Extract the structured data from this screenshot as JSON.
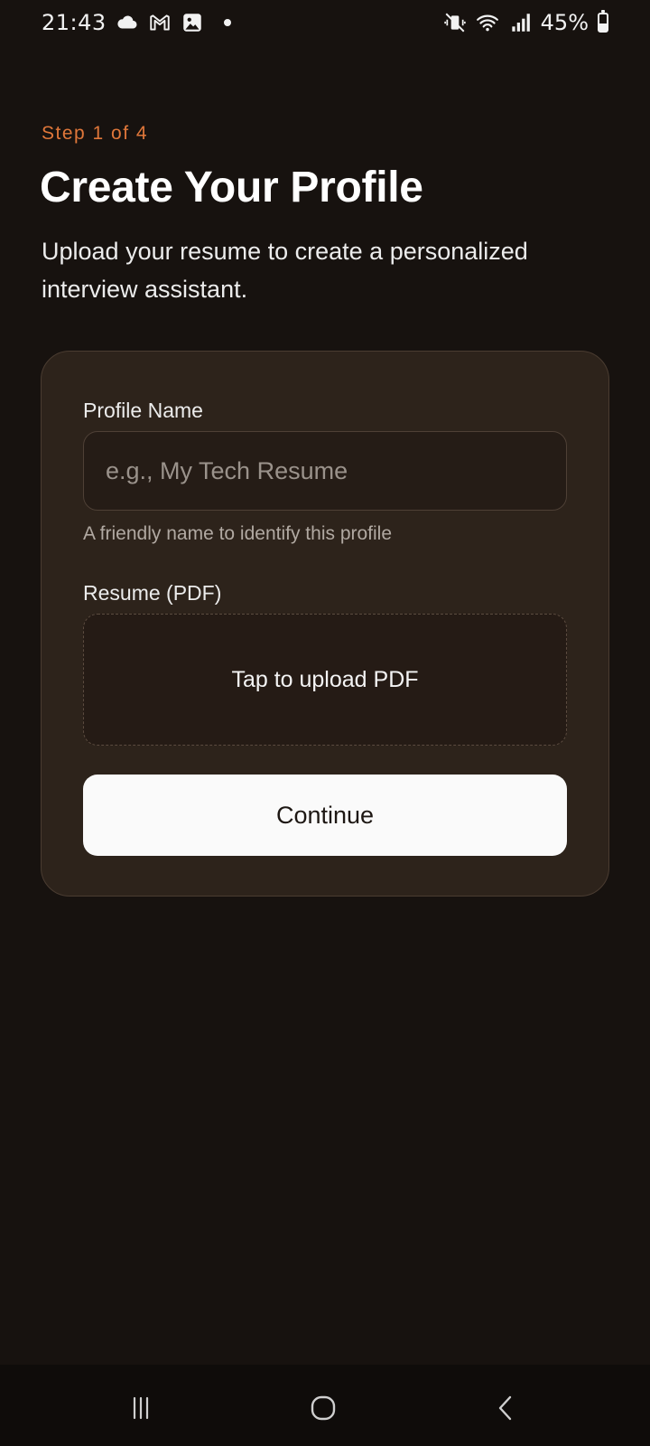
{
  "status_bar": {
    "time": "21:43",
    "battery": "45%",
    "battery_level": 0.45,
    "icons": [
      "cloud-icon",
      "gmail-icon",
      "gallery-icon",
      "notification-dot-icon",
      "mute-vibrate-icon",
      "wifi-icon",
      "signal-icon",
      "battery-icon"
    ]
  },
  "header": {
    "step": "Step 1 of 4",
    "title": "Create Your Profile",
    "subtitle": "Upload your resume to create a personalized interview assistant."
  },
  "form": {
    "profile_name": {
      "label": "Profile Name",
      "placeholder": "e.g., My Tech Resume",
      "value": "",
      "helper": "A friendly name to identify this profile"
    },
    "resume": {
      "label": "Resume (PDF)",
      "upload_text": "Tap to upload PDF"
    },
    "continue_label": "Continue"
  },
  "colors": {
    "background": "#17120f",
    "card": "#2d231b",
    "accent": "#e0773a",
    "button": "#fafafa"
  },
  "nav_bar": {
    "icons": [
      "recent-apps-icon",
      "home-icon",
      "back-icon"
    ]
  }
}
